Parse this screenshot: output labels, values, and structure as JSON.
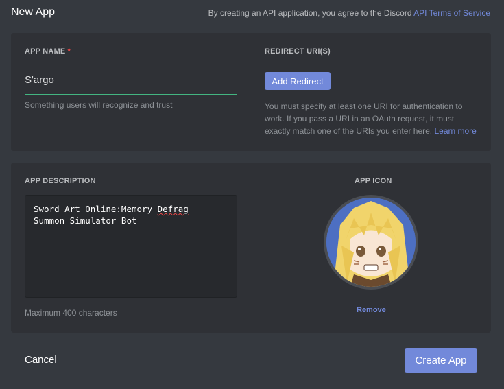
{
  "header": {
    "title": "New App",
    "terms_prefix": "By creating an API application, you agree to the Discord",
    "terms_link": "API Terms of Service"
  },
  "app_name": {
    "label": "APP NAME",
    "required_mark": "*",
    "value": "S'argo",
    "hint": "Something users will recognize and trust"
  },
  "redirect": {
    "label": "REDIRECT URI(S)",
    "add_button": "Add Redirect",
    "help_text": "You must specify at least one URI for authentication to work. If you pass a URI in an OAuth request, it must exactly match one of the URIs you enter here.",
    "learn_more": "Learn more"
  },
  "description": {
    "label": "APP DESCRIPTION",
    "value_line1_pre": "Sword Art Online:Memory ",
    "value_line1_misspelled": "Defrag",
    "value_line2": "Summon Simulator Bot",
    "hint": "Maximum 400 characters"
  },
  "icon": {
    "label": "APP ICON",
    "remove": "Remove",
    "image_name": "anime-character-avatar"
  },
  "footer": {
    "cancel": "Cancel",
    "create": "Create App"
  },
  "colors": {
    "background": "#35393f",
    "card": "#2f3136",
    "accent": "#7289da",
    "focus_underline": "#43b581",
    "required": "#f04747"
  }
}
